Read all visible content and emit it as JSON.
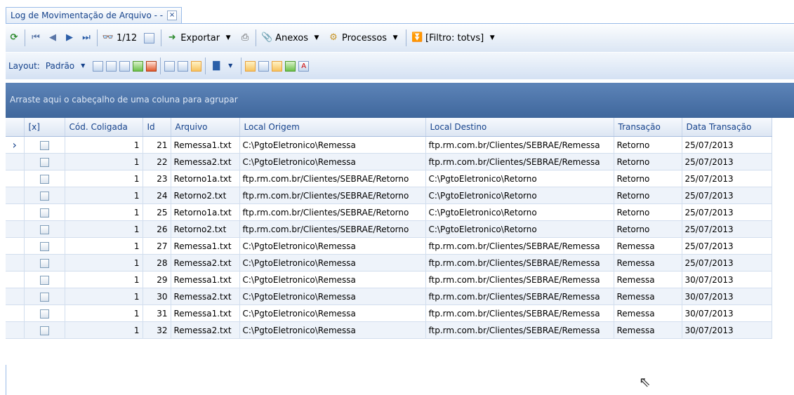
{
  "tab": {
    "title": "Log de Movimentação de Arquivo - -",
    "close": "×"
  },
  "toolbar": {
    "refresh_icon": "refresh-icon",
    "page_indicator": "1/12",
    "export_label": "Exportar",
    "attachments_label": "Anexos",
    "processes_label": "Processos",
    "filter_label": "[Filtro: totvs]"
  },
  "layout_bar": {
    "layout_label": "Layout:",
    "layout_value": "Padrão"
  },
  "group_hint": "Arraste aqui o cabeçalho de uma coluna para agrupar",
  "columns": [
    "[x]",
    "Cód. Coligada",
    "Id",
    "Arquivo",
    "Local Origem",
    "Local Destino",
    "Transação",
    "Data Transação"
  ],
  "rows": [
    {
      "coligada": "1",
      "id": "21",
      "arquivo": "Remessa1.txt",
      "origem": "C:\\PgtoEletronico\\Remessa",
      "destino": "ftp.rm.com.br/Clientes/SEBRAE/Remessa",
      "transacao": "Retorno",
      "data": "25/07/2013"
    },
    {
      "coligada": "1",
      "id": "22",
      "arquivo": "Remessa2.txt",
      "origem": "C:\\PgtoEletronico\\Remessa",
      "destino": "ftp.rm.com.br/Clientes/SEBRAE/Remessa",
      "transacao": "Retorno",
      "data": "25/07/2013"
    },
    {
      "coligada": "1",
      "id": "23",
      "arquivo": "Retorno1a.txt",
      "origem": "ftp.rm.com.br/Clientes/SEBRAE/Retorno",
      "destino": "C:\\PgtoEletronico\\Retorno",
      "transacao": "Retorno",
      "data": "25/07/2013"
    },
    {
      "coligada": "1",
      "id": "24",
      "arquivo": "Retorno2.txt",
      "origem": "ftp.rm.com.br/Clientes/SEBRAE/Retorno",
      "destino": "C:\\PgtoEletronico\\Retorno",
      "transacao": "Retorno",
      "data": "25/07/2013"
    },
    {
      "coligada": "1",
      "id": "25",
      "arquivo": "Retorno1a.txt",
      "origem": "ftp.rm.com.br/Clientes/SEBRAE/Retorno",
      "destino": "C:\\PgtoEletronico\\Retorno",
      "transacao": "Retorno",
      "data": "25/07/2013"
    },
    {
      "coligada": "1",
      "id": "26",
      "arquivo": "Retorno2.txt",
      "origem": "ftp.rm.com.br/Clientes/SEBRAE/Retorno",
      "destino": "C:\\PgtoEletronico\\Retorno",
      "transacao": "Retorno",
      "data": "25/07/2013"
    },
    {
      "coligada": "1",
      "id": "27",
      "arquivo": "Remessa1.txt",
      "origem": "C:\\PgtoEletronico\\Remessa",
      "destino": "ftp.rm.com.br/Clientes/SEBRAE/Remessa",
      "transacao": "Remessa",
      "data": "25/07/2013"
    },
    {
      "coligada": "1",
      "id": "28",
      "arquivo": "Remessa2.txt",
      "origem": "C:\\PgtoEletronico\\Remessa",
      "destino": "ftp.rm.com.br/Clientes/SEBRAE/Remessa",
      "transacao": "Remessa",
      "data": "25/07/2013"
    },
    {
      "coligada": "1",
      "id": "29",
      "arquivo": "Remessa1.txt",
      "origem": "C:\\PgtoEletronico\\Remessa",
      "destino": "ftp.rm.com.br/Clientes/SEBRAE/Remessa",
      "transacao": "Remessa",
      "data": "30/07/2013"
    },
    {
      "coligada": "1",
      "id": "30",
      "arquivo": "Remessa2.txt",
      "origem": "C:\\PgtoEletronico\\Remessa",
      "destino": "ftp.rm.com.br/Clientes/SEBRAE/Remessa",
      "transacao": "Remessa",
      "data": "30/07/2013"
    },
    {
      "coligada": "1",
      "id": "31",
      "arquivo": "Remessa1.txt",
      "origem": "C:\\PgtoEletronico\\Remessa",
      "destino": "ftp.rm.com.br/Clientes/SEBRAE/Remessa",
      "transacao": "Remessa",
      "data": "30/07/2013"
    },
    {
      "coligada": "1",
      "id": "32",
      "arquivo": "Remessa2.txt",
      "origem": "C:\\PgtoEletronico\\Remessa",
      "destino": "ftp.rm.com.br/Clientes/SEBRAE/Remessa",
      "transacao": "Remessa",
      "data": "30/07/2013"
    }
  ],
  "selected_row_index": 0,
  "colors": {
    "group_area": "#466fa5",
    "border": "#99bbe8",
    "header_text": "#15428b"
  }
}
